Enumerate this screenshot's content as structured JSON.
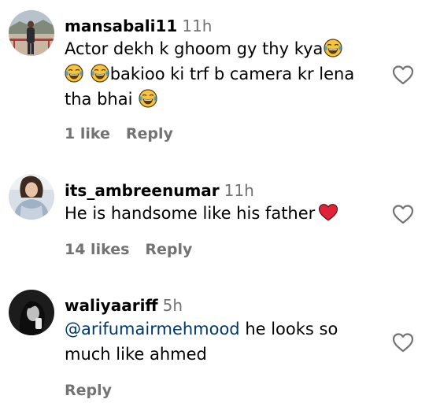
{
  "comments": [
    {
      "username": "mansabali11",
      "time": "11h",
      "text_parts": [
        "Actor dekh k ghoom gy thy kya",
        "bakioo ki trf b camera kr lena",
        "tha bhai"
      ],
      "emoji": "face-with-tears-of-joy-icon",
      "likes": "1 like",
      "reply": "Reply"
    },
    {
      "username": "its_ambreenumar",
      "time": "11h",
      "text": "He is handsome like his father",
      "emoji": "red-heart-icon",
      "likes": "14 likes",
      "reply": "Reply"
    },
    {
      "username": "waliyaariff",
      "time": "5h",
      "mention": "@arifumairmehmood",
      "text": " he looks so much like ahmed",
      "reply": "Reply"
    }
  ],
  "colors": {
    "text": "#000000",
    "muted": "#737373",
    "mention": "#00376b",
    "heart_red": "#e0213a",
    "emoji_yellow": "#f7c53a"
  }
}
